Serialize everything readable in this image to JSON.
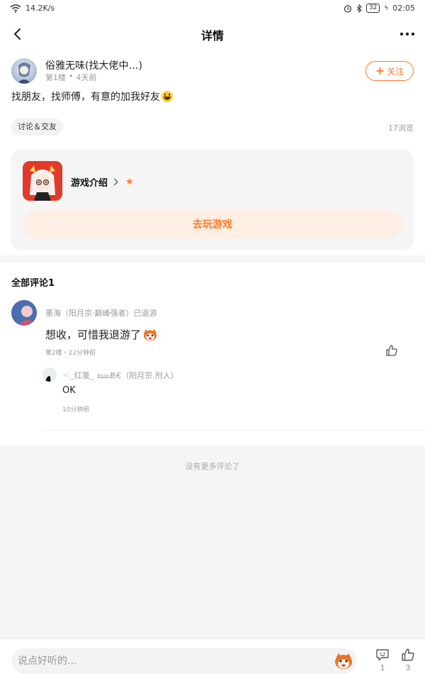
{
  "status_bar": {
    "net_speed": "14.2K/s",
    "battery": "32",
    "time": "02:05"
  },
  "header": {
    "title": "详情"
  },
  "post": {
    "author": "俗雅无味(找大佬中…)",
    "floor": "第1楼",
    "dot": "•",
    "time": "4天前",
    "follow_label": "关注",
    "content": "找朋友，找师傅，有意的加我好友",
    "tag": "讨论＆交友",
    "views": "17浏览",
    "game": {
      "intro_label": "游戏介绍",
      "play_label": "去玩游戏"
    }
  },
  "comments": {
    "title": "全部评论1",
    "items": [
      {
        "user": "墨海（阳月宗·巅峰强者）已退游",
        "text": "想收，可惜我退游了",
        "meta": "第2楼・22分钟前",
        "replies": [
          {
            "user": "☜ ̗ ̗红笺 ̗ ̗ ఋあ€（阳月宗.刑人）",
            "text": "OK",
            "time": "10分钟前"
          }
        ]
      }
    ],
    "no_more": "没有更多评论了"
  },
  "bottom_bar": {
    "placeholder": "说点好听的...",
    "comment_count": "1",
    "like_count": "3"
  },
  "colors": {
    "accent": "#ff7a2a",
    "background": "#f5f5f5"
  }
}
